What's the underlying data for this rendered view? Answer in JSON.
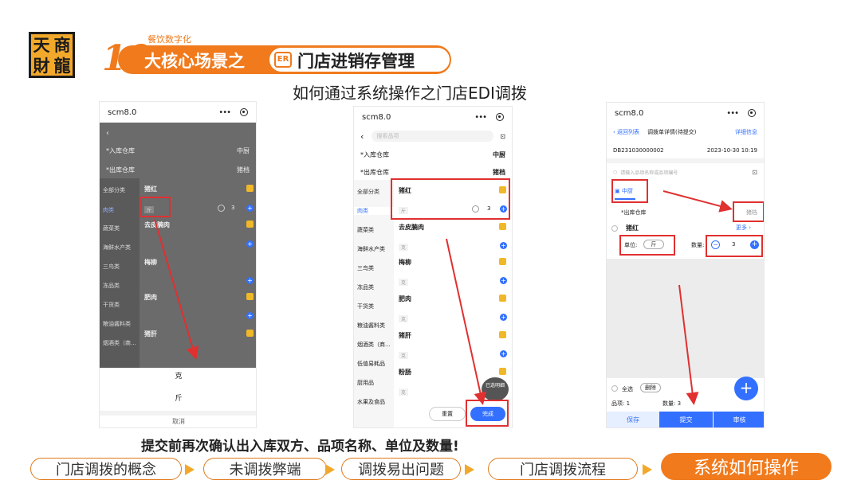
{
  "header": {
    "logo_chars": [
      "天",
      "商",
      "財",
      "龍"
    ],
    "ten": "10",
    "eyebrow": "餐饮数字化",
    "title_main": "大核心场景之",
    "title_icon": "icon-badge",
    "title_pill": "门店进销存管理",
    "subtitle": "如何通过系统操作之门店EDI调拨"
  },
  "phone1": {
    "app_title": "scm8.0",
    "menu": "•••",
    "in_warehouse_label": "*入库仓库",
    "in_warehouse_value": "中厨",
    "out_warehouse_label": "*出库仓库",
    "out_warehouse_value": "猪档",
    "categories": [
      "全部分类",
      "肉类",
      "蔬菜类",
      "海鲜水产类",
      "三鸟类",
      "冻品类",
      "干货类",
      "粮油酱料类",
      "烟酒类（商..."
    ],
    "items": [
      "猪红",
      "去皮腩肉",
      "梅柳",
      "肥肉",
      "猪肝"
    ],
    "unit_value": "斤",
    "qty": "3",
    "sheet_options": [
      "克",
      "斤"
    ],
    "sheet_cancel": "取消"
  },
  "phone2": {
    "app_title": "scm8.0",
    "menu": "•••",
    "search_placeholder": "搜索品项",
    "in_warehouse_label": "*入库仓库",
    "in_warehouse_value": "中厨",
    "out_warehouse_label": "*出库仓库",
    "out_warehouse_value": "猪档",
    "categories": [
      "全部分类",
      "肉类",
      "蔬菜类",
      "海鲜水产类",
      "三鸟类",
      "冻品类",
      "干货类",
      "粮油酱料类",
      "烟酒类（商...",
      "低值易耗品",
      "厨用品",
      "水果及食品"
    ],
    "items": [
      "猪红",
      "去皮腩肉",
      "梅柳",
      "肥肉",
      "猪肝",
      "粉肠"
    ],
    "unit_jin": "斤",
    "unit_ke": "克",
    "qty": "3",
    "selected_badge": "已选明细",
    "reset_label": "重置",
    "done_label": "完成"
  },
  "phone3": {
    "app_title": "scm8.0",
    "menu": "•••",
    "back_label": "返回列表",
    "page_title": "调拨单详情(待提交)",
    "detail_link": "详细信息",
    "doc_no": "DB231030000002",
    "doc_time": "2023-10-30 10:19",
    "search_placeholder": "请输入品项名称或品项编号",
    "tab_label": "中厨",
    "out_label": "*出库仓库",
    "out_value": "猪档",
    "item_name": "猪红",
    "more_label": "更多",
    "unit_label": "单位:",
    "unit_value": "斤",
    "qty_label": "数量:",
    "qty_value": "3",
    "select_all": "全选",
    "delete_label": "删除",
    "item_count": "品项: 1",
    "qty_count": "数量: 3",
    "btn_save": "保存",
    "btn_submit": "提交",
    "btn_review": "审核"
  },
  "note": "提交前再次确认出入库双方、品项名称、单位及数量!",
  "steps": [
    "门店调拨的概念",
    "未调拨弊端",
    "调拨易出问题",
    "门店调拨流程",
    "系统如何操作"
  ],
  "colors": {
    "accent": "#f07a1c",
    "primary": "#3370ff",
    "highlight": "#e03030",
    "gold": "#f0b829"
  }
}
